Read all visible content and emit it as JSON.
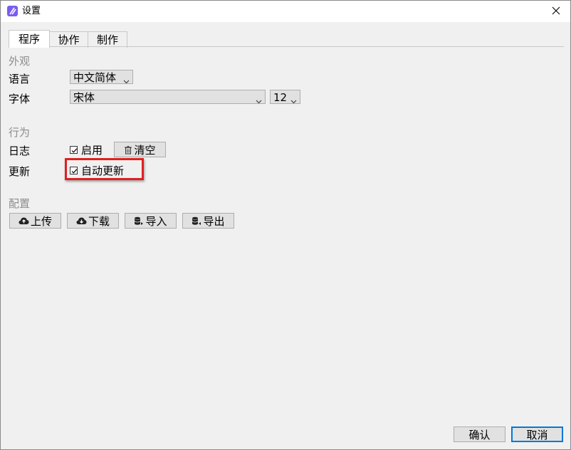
{
  "window": {
    "title": "设置"
  },
  "tabs": [
    {
      "label": "程序",
      "active": true
    },
    {
      "label": "协作",
      "active": false
    },
    {
      "label": "制作",
      "active": false
    }
  ],
  "appearance": {
    "section_title": "外观",
    "language_label": "语言",
    "language_value": "中文简体",
    "font_label": "字体",
    "font_value": "宋体",
    "font_size_value": "12"
  },
  "behavior": {
    "section_title": "行为",
    "log_label": "日志",
    "log_enable_label": "启用",
    "log_enable_checked": true,
    "clear_label": "清空",
    "update_label": "更新",
    "auto_update_label": "自动更新",
    "auto_update_checked": true
  },
  "config": {
    "section_title": "配置",
    "upload_label": "上传",
    "download_label": "下载",
    "import_label": "导入",
    "export_label": "导出"
  },
  "footer": {
    "ok_label": "确认",
    "cancel_label": "取消"
  },
  "colors": {
    "accent": "#0078d7",
    "highlight": "#e02020",
    "app_icon": "#7a5cf0"
  },
  "icons": {
    "app": "app-logo-icon",
    "close": "close-icon",
    "dropdown": "chevron-down-icon",
    "trash": "trash-icon",
    "upload": "cloud-upload-icon",
    "download": "cloud-download-icon",
    "import": "database-import-icon",
    "export": "database-export-icon"
  }
}
